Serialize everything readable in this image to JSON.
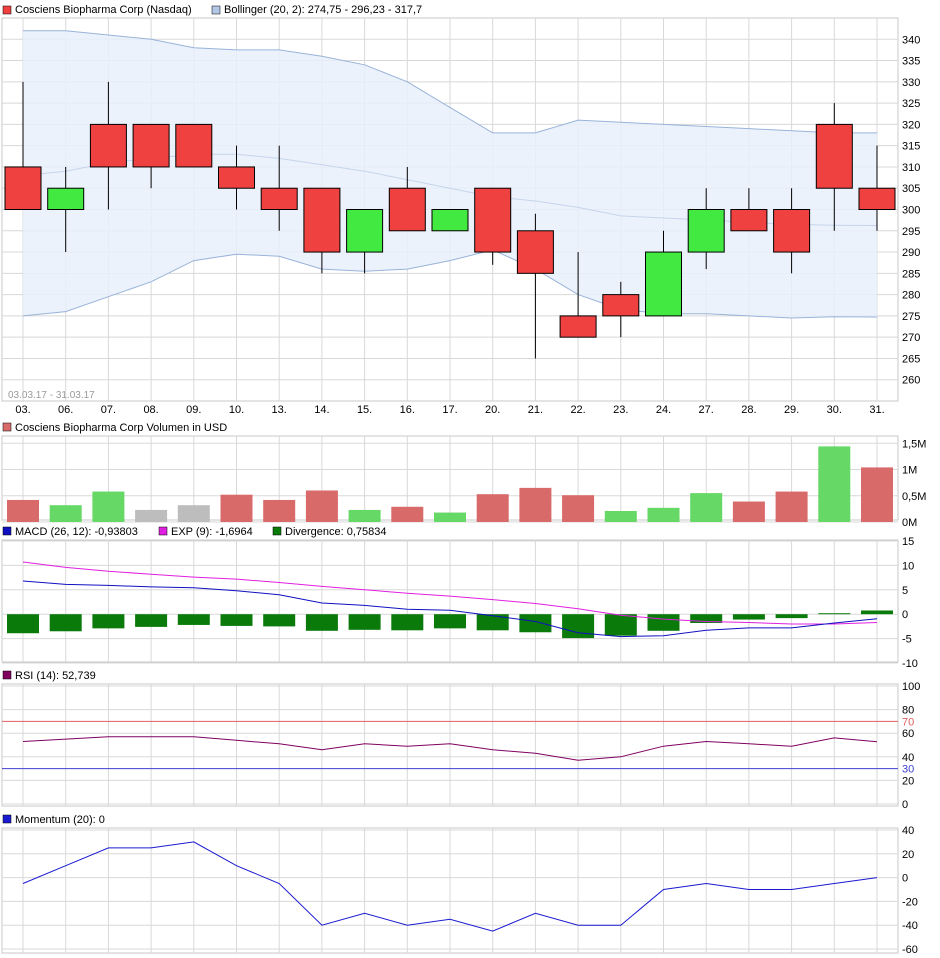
{
  "colors": {
    "up": "#41e941",
    "down": "#f04141",
    "vol_up": "#66d866",
    "vol_down": "#d96a6a",
    "vol_neutral": "#bdbdbd",
    "bollinger_fill": "#e8f0fc",
    "bollinger_line": "#99b3d9",
    "macd": "#1010c0",
    "exp": "#e020e0",
    "divergence": "#0a7a0a",
    "rsi": "#800060",
    "rsi_upper": "#e06060",
    "rsi_lower": "#4040d0",
    "momentum": "#1a1ad0",
    "grid": "#d8d8d8"
  },
  "header": {
    "title": "Cosciens Biopharma Corp (Nasdaq)",
    "bollinger": "Bollinger (20, 2): 274,75 - 296,23 - 317,7"
  },
  "range_note": "03.03.17 - 31.03.17",
  "chart_data": [
    {
      "type": "candlestick",
      "title": "Cosciens Biopharma Corp (Nasdaq)",
      "x": [
        "03.",
        "06.",
        "07.",
        "08.",
        "09.",
        "10.",
        "13.",
        "14.",
        "15.",
        "16.",
        "17.",
        "20.",
        "21.",
        "22.",
        "23.",
        "24.",
        "27.",
        "28.",
        "29.",
        "30.",
        "31."
      ],
      "open": [
        310,
        300,
        320,
        320,
        320,
        310,
        305,
        305,
        290,
        305,
        295,
        305,
        295,
        275,
        280,
        275,
        290,
        300,
        300,
        320,
        305
      ],
      "high": [
        330,
        310,
        330,
        320,
        320,
        315,
        315,
        305,
        300,
        310,
        300,
        305,
        299,
        290,
        283,
        295,
        305,
        305,
        305,
        325,
        315
      ],
      "low": [
        300,
        290,
        300,
        305,
        310,
        300,
        295,
        285,
        285,
        295,
        295,
        287,
        265,
        270,
        270,
        275,
        286,
        295,
        285,
        295,
        295
      ],
      "close": [
        300,
        305,
        310,
        310,
        310,
        305,
        300,
        290,
        300,
        295,
        300,
        290,
        285,
        270,
        275,
        290,
        300,
        295,
        290,
        305,
        300
      ],
      "bollinger": {
        "upper": [
          342,
          342,
          341,
          340,
          338,
          337.5,
          337.5,
          336,
          334,
          330,
          324,
          318,
          318,
          321,
          320.5,
          320,
          319.5,
          319,
          318.5,
          318,
          318
        ],
        "middle": [
          308,
          309,
          311,
          312,
          313,
          313,
          312,
          310.5,
          309,
          307,
          305,
          303,
          302,
          300.5,
          298.5,
          298,
          297.5,
          297,
          296.5,
          296.3,
          296.23
        ],
        "lower": [
          275,
          276,
          279.5,
          283,
          288,
          289.5,
          289,
          286,
          285.5,
          286,
          288,
          290.5,
          286,
          280,
          276.5,
          275.5,
          275.5,
          275,
          274.5,
          274.8,
          274.75
        ]
      },
      "ylim": [
        255,
        345
      ],
      "yticks": [
        260,
        265,
        270,
        275,
        280,
        285,
        290,
        295,
        300,
        305,
        310,
        315,
        320,
        325,
        330,
        335,
        340
      ],
      "legend": [
        "Cosciens Biopharma Corp (Nasdaq)",
        "Bollinger (20, 2): 274,75 - 296,23 - 317,7"
      ]
    },
    {
      "type": "bar",
      "title": "Cosciens Biopharma Corp Volumen in USD",
      "x": [
        "03.",
        "06.",
        "07.",
        "08.",
        "09.",
        "10.",
        "13.",
        "14.",
        "15.",
        "16.",
        "17.",
        "20.",
        "21.",
        "22.",
        "23.",
        "24.",
        "27.",
        "28.",
        "29.",
        "30.",
        "31."
      ],
      "values": [
        0.42,
        0.32,
        0.58,
        0.23,
        0.32,
        0.52,
        0.42,
        0.6,
        0.23,
        0.29,
        0.18,
        0.53,
        0.65,
        0.51,
        0.21,
        0.27,
        0.55,
        0.39,
        0.58,
        1.44,
        1.04
      ],
      "direction": [
        "down",
        "up",
        "up",
        "neutral",
        "neutral",
        "down",
        "down",
        "down",
        "up",
        "down",
        "up",
        "down",
        "down",
        "down",
        "up",
        "up",
        "up",
        "down",
        "down",
        "up",
        "down"
      ],
      "ylim": [
        0,
        1.6
      ],
      "yticks": [
        0,
        0.5,
        1,
        1.5
      ],
      "ytick_labels": [
        "0M",
        "0,5M",
        "1M",
        "1,5M"
      ]
    },
    {
      "type": "line",
      "title": "MACD",
      "x": [
        "03.",
        "06.",
        "07.",
        "08.",
        "09.",
        "10.",
        "13.",
        "14.",
        "15.",
        "16.",
        "17.",
        "20.",
        "21.",
        "22.",
        "23.",
        "24.",
        "27.",
        "28.",
        "29.",
        "30.",
        "31."
      ],
      "series": [
        {
          "name": "MACD (26, 12): -0,93803",
          "values": [
            6.8,
            6.1,
            5.9,
            5.6,
            5.4,
            4.8,
            4.0,
            2.3,
            1.8,
            1.0,
            0.8,
            -0.3,
            -1.5,
            -3.8,
            -4.6,
            -4.4,
            -3.3,
            -2.8,
            -2.8,
            -1.8,
            -0.94
          ]
        },
        {
          "name": "EXP (9): -1,6964",
          "values": [
            10.7,
            9.6,
            8.8,
            8.2,
            7.6,
            7.2,
            6.5,
            5.7,
            5.0,
            4.3,
            3.7,
            3.0,
            2.2,
            1.1,
            -0.2,
            -1.0,
            -1.5,
            -1.7,
            -2.0,
            -2.0,
            -1.7
          ]
        },
        {
          "name": "Divergence: 0,75834",
          "values": [
            -3.9,
            -3.5,
            -2.9,
            -2.6,
            -2.2,
            -2.4,
            -2.5,
            -3.4,
            -3.2,
            -3.3,
            -2.9,
            -3.3,
            -3.7,
            -4.9,
            -4.4,
            -3.4,
            -1.8,
            -1.1,
            -0.8,
            0.2,
            0.76
          ]
        }
      ],
      "ylim": [
        -10,
        15
      ],
      "yticks": [
        -10,
        -5,
        0,
        5,
        10,
        15
      ]
    },
    {
      "type": "line",
      "title": "RSI (14): 52,739",
      "x": [
        "03.",
        "06.",
        "07.",
        "08.",
        "09.",
        "10.",
        "13.",
        "14.",
        "15.",
        "16.",
        "17.",
        "20.",
        "21.",
        "22.",
        "23.",
        "24.",
        "27.",
        "28.",
        "29.",
        "30.",
        "31."
      ],
      "series": [
        {
          "name": "RSI (14): 52,739",
          "values": [
            53,
            55,
            57,
            57,
            57,
            54,
            51,
            46,
            51,
            49,
            51,
            46,
            43,
            37,
            40,
            49,
            53,
            51,
            49,
            56,
            52.7
          ]
        }
      ],
      "reference_lines": [
        70,
        30
      ],
      "ylim": [
        0,
        100
      ],
      "yticks": [
        0,
        20,
        40,
        60,
        80,
        100
      ]
    },
    {
      "type": "line",
      "title": "Momentum (20): 0",
      "x": [
        "03.",
        "06.",
        "07.",
        "08.",
        "09.",
        "10.",
        "13.",
        "14.",
        "15.",
        "16.",
        "17.",
        "20.",
        "21.",
        "22.",
        "23.",
        "24.",
        "27.",
        "28.",
        "29.",
        "30.",
        "31."
      ],
      "series": [
        {
          "name": "Momentum (20): 0",
          "values": [
            -5,
            10,
            25,
            25,
            30,
            10,
            -5,
            -40,
            -30,
            -40,
            -35,
            -45,
            -30,
            -40,
            -40,
            -10,
            -5,
            -10,
            -10,
            -5,
            0
          ]
        }
      ],
      "ylim": [
        -60,
        40
      ],
      "yticks": [
        -60,
        -40,
        -20,
        0,
        20,
        40
      ]
    }
  ],
  "legends": {
    "price_label": "Cosciens Biopharma Corp (Nasdaq)",
    "bollinger_label": "Bollinger (20, 2): 274,75 - 296,23 - 317,7",
    "volume_label": "Cosciens Biopharma Corp Volumen in USD",
    "macd_label": "MACD (26, 12): -0,93803",
    "exp_label": "EXP (9): -1,6964",
    "divergence_label": "Divergence: 0,75834",
    "rsi_label": "RSI (14): 52,739",
    "momentum_label": "Momentum (20): 0"
  }
}
